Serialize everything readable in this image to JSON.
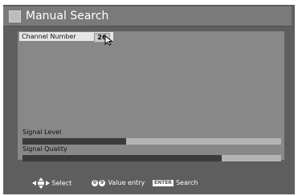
{
  "window": {
    "title": "Manual Search"
  },
  "channel": {
    "label": "Channel Number",
    "value": "26"
  },
  "signal": {
    "level_label": "Signal Level",
    "level_fraction": 0.4,
    "quality_label": "Signal Quality",
    "quality_fraction": 0.77
  },
  "footer": {
    "select_label": "Select",
    "value_entry_label": "Value entry",
    "value_entry_keys": [
      "0",
      "9"
    ],
    "enter_key": "ENTER",
    "search_label": "Search"
  },
  "colors": {
    "screen_bg": "#5e5e5e",
    "panel_bg": "#888888",
    "bar_fill": "#3b3b3b",
    "bar_track": "#b3b3b3"
  },
  "icons": {
    "title": "menu-square-icon",
    "cursor": "pointer-cursor-icon",
    "dpad": "dpad-icon"
  }
}
